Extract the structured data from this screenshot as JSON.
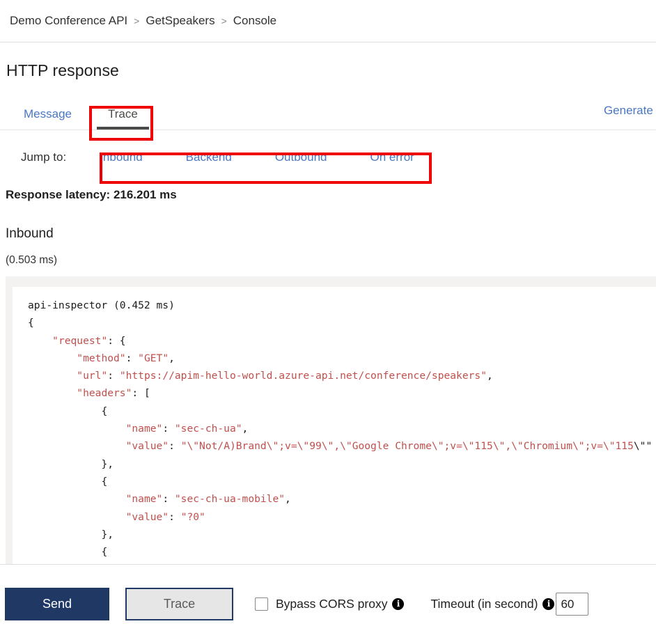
{
  "breadcrumb": {
    "items": [
      "Demo Conference API",
      "GetSpeakers",
      "Console"
    ],
    "separator": ">"
  },
  "page": {
    "title": "HTTP response"
  },
  "tabs": {
    "message_label": "Message",
    "trace_label": "Trace",
    "generate_link_label": "Generate d"
  },
  "jump": {
    "label": "Jump to:",
    "links": [
      "Inbound",
      "Backend",
      "Outbound",
      "On error"
    ]
  },
  "trace": {
    "latency_label": "Response latency: 216.201 ms",
    "section_title": "Inbound",
    "section_time": "(0.503 ms)"
  },
  "code": {
    "line1_plain": "api-inspector (0.452 ms)",
    "line2_plain": "{",
    "l3_key": "\"request\"",
    "l3_rest": ": {",
    "l4_key": "\"method\"",
    "l4_sep": ": ",
    "l4_val": "\"GET\"",
    "l4_tail": ",",
    "l5_key": "\"url\"",
    "l5_sep": ": ",
    "l5_val": "\"https://apim-hello-world.azure-api.net/conference/speakers\"",
    "l5_tail": ",",
    "l6_key": "\"headers\"",
    "l6_rest": ": [",
    "l7_plain": "{",
    "l8_key": "\"name\"",
    "l8_sep": ": ",
    "l8_val": "\"sec-ch-ua\"",
    "l8_tail": ",",
    "l9_key": "\"value\"",
    "l9_sep": ": ",
    "l9_val": "\"\\\"Not/A)Brand\\\";v=\\\"99\\\",\\\"Google Chrome\\\";v=\\\"115\\\",\\\"Chromium\\\";v=\\\"115",
    "l9_wrap": "\\\"\"",
    "l10_plain": "},",
    "l11_plain": "{",
    "l12_key": "\"name\"",
    "l12_sep": ": ",
    "l12_val": "\"sec-ch-ua-mobile\"",
    "l12_tail": ",",
    "l13_key": "\"value\"",
    "l13_sep": ": ",
    "l13_val": "\"?0\"",
    "l14_plain": "},",
    "l15_plain": "{"
  },
  "footer": {
    "send_label": "Send",
    "trace_label": "Trace",
    "cors_label": "Bypass CORS proxy",
    "cors_checked": false,
    "info_glyph": "i",
    "timeout_label": "Timeout (in second)",
    "timeout_value": "60"
  },
  "colors": {
    "accent_blue": "#4a77c4",
    "send_navy": "#1f3864",
    "annotation_red": "#ef0000",
    "code_string": "#c0504d",
    "panel_gray": "#f3f2f1"
  }
}
